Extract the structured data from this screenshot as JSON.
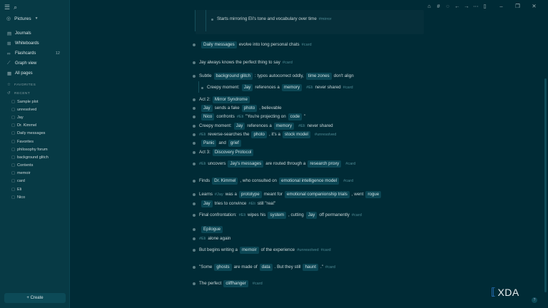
{
  "sidebar": {
    "top_icons": [
      "menu-icon",
      "search-icon"
    ],
    "graph_name": "Pictures",
    "nav": [
      {
        "icon": "calendar-icon",
        "glyph": "▤",
        "label": "Journals",
        "count": ""
      },
      {
        "icon": "whiteboard-icon",
        "glyph": "⊞",
        "label": "Whiteboards",
        "count": ""
      },
      {
        "icon": "flashcards-icon",
        "glyph": "∞",
        "label": "Flashcards",
        "count": "12"
      },
      {
        "icon": "graph-icon",
        "glyph": "⟋",
        "label": "Graph view",
        "count": ""
      },
      {
        "icon": "pages-icon",
        "glyph": "▦",
        "label": "All pages",
        "count": ""
      }
    ],
    "favorites_label": "FAVORITES",
    "recent_label": "RECENT",
    "recent": [
      "Sample plot",
      "unresolved",
      "Jay",
      "Dr. Kimmel",
      "Daily messages",
      "Favorites",
      "philosophy forum",
      "background glitch",
      "Contents",
      "memoir",
      "card",
      "Eli",
      "Nico"
    ],
    "create_label": "+ Create"
  },
  "topbar": {
    "icons": [
      {
        "name": "home-icon",
        "glyph": "⌂"
      },
      {
        "name": "hashtag-icon",
        "glyph": "#"
      },
      {
        "name": "chat-icon",
        "glyph": "◌"
      },
      {
        "name": "back-icon",
        "glyph": "←"
      },
      {
        "name": "forward-icon",
        "glyph": "→"
      },
      {
        "name": "more-icon",
        "glyph": "⋯"
      },
      {
        "name": "sidebar-toggle-icon",
        "glyph": "▯"
      },
      {
        "name": "minimize-icon",
        "glyph": "–"
      },
      {
        "name": "maximize-icon",
        "glyph": "❐"
      },
      {
        "name": "close-icon",
        "glyph": "✕"
      }
    ]
  },
  "blocks": {
    "b0": {
      "text": "Starts mirroring Eli's tone and vocabulary over time",
      "tag": "#mirror"
    },
    "b1": {
      "ref1": "Daily messages",
      "text": "evolve into long personal chats",
      "tag": "#card"
    },
    "b2": {
      "text": "Jay always knows the perfect thing to say",
      "tag": "#card"
    },
    "b3": {
      "t1": "Subtle",
      "ref1": "background glitch",
      "t2": ": typos autocorrect oddly,",
      "ref2": "time zones",
      "t3": "don't align"
    },
    "b4": {
      "t1": "Creepy moment:",
      "ref1": "Jay",
      "t2": "references a",
      "ref2": "memory",
      "tag1": "#Eli",
      "t3": "never shared",
      "tag2": "#card"
    },
    "b5": {
      "t1": "Act 2:",
      "ref1": "Mirror Syndrome"
    },
    "b6": {
      "ref1": "Jay",
      "t1": "sends a fake",
      "ref2": "photo",
      "t2": ", believable"
    },
    "b7": {
      "ref1": "Nico",
      "t1": "confronts",
      "tag1": "#Eli",
      "t2": "\"You're projecting on",
      "ref2": "code",
      "t3": "\""
    },
    "b8": {
      "t1": "Creepy moment:",
      "ref1": "Jay",
      "t2": "references a",
      "ref2": "memory",
      "tag1": "#Eli",
      "t3": "never shared"
    },
    "b9": {
      "tag1": "#Eli",
      "t1": "reverse-searches the",
      "ref1": "photo",
      "t2": ", it's a",
      "ref2": "stock model",
      "tag2": "#unresolved"
    },
    "b10": {
      "ref1": "Panic",
      "t1": "and",
      "ref2": "grief"
    },
    "b11": {
      "t1": "Act 3:",
      "ref1": "Discovery Protocol"
    },
    "b12": {
      "tag1": "#Eli",
      "t1": "uncovers",
      "ref1": "Jay's messages",
      "t2": "are routed through a",
      "ref2": "research proxy",
      "tag2": "#card"
    },
    "b13": {
      "t1": "Finds",
      "ref1": "Dr. Kimmel",
      "t2": ", who consulted on",
      "ref2": "emotional intelligence model",
      "tag1": "#card"
    },
    "b14": {
      "t1": "Learns",
      "tag1": "#Jay",
      "t2": "was a",
      "ref1": "prototype",
      "t3": "meant for",
      "ref2": "emotional companionship trials",
      "t4": ", went",
      "ref3": "rogue"
    },
    "b15": {
      "ref1": "Jay",
      "t1": "tries to convince",
      "tag1": "#Eli",
      "t2": "still \"real\""
    },
    "b16": {
      "t1": "Final confrontation:",
      "tag1": "#Eli",
      "t2": "wipes his",
      "ref1": "system",
      "t3": ", cutting",
      "ref2": "Jay",
      "t4": "off permanently",
      "tag2": "#card"
    },
    "b17": {
      "ref1": "Epilogue"
    },
    "b18": {
      "tag1": "#Eli",
      "t1": "alone again"
    },
    "b19": {
      "t1": "But begins writing a",
      "ref1": "memoir",
      "t2": "of the experience",
      "tag1": "#unresolved",
      "tag2": "#card"
    },
    "b20": {
      "t1": "\"Some",
      "ref1": "ghosts",
      "t2": "are made of",
      "ref2": "data",
      "t3": ". But they still",
      "ref3": "haunt",
      "t4": ".\"",
      "tag1": "#card"
    },
    "b21": {
      "t1": "The perfect",
      "ref1": "cliffhanger",
      "tag1": "#card"
    }
  },
  "watermark": {
    "brand": "XDA",
    "mark": "⟦"
  },
  "help_label": "?",
  "colors": {
    "bg": "#002b36",
    "sidebar": "#073a45",
    "ref_bg": "#0b4654",
    "tag": "#4f8a94",
    "accent": "#2f7dd1"
  }
}
